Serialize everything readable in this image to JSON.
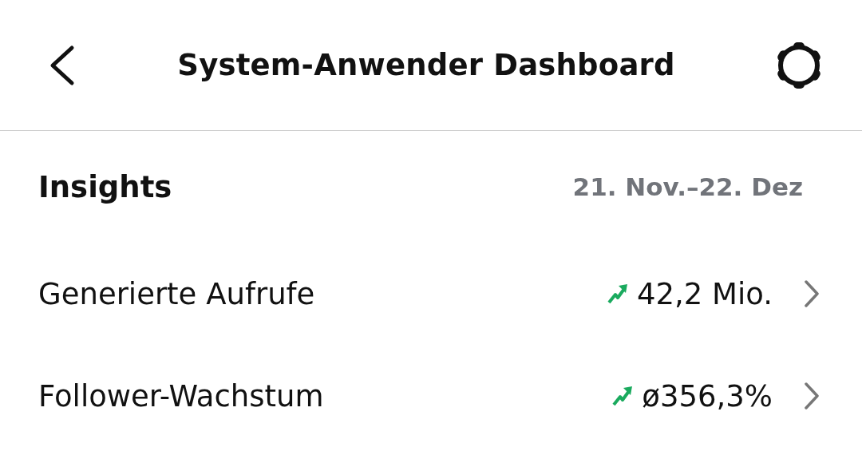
{
  "header": {
    "title": "System-Anwender Dashboard"
  },
  "section": {
    "title": "Insights",
    "date_range": "21. Nov.–22. Dez"
  },
  "metrics": [
    {
      "label": "Generierte Aufrufe",
      "value": "42,2 Mio.",
      "kind": "rising"
    },
    {
      "label": "Follower-Wachstum",
      "value": "ø356,3%",
      "kind": "rising"
    }
  ]
}
